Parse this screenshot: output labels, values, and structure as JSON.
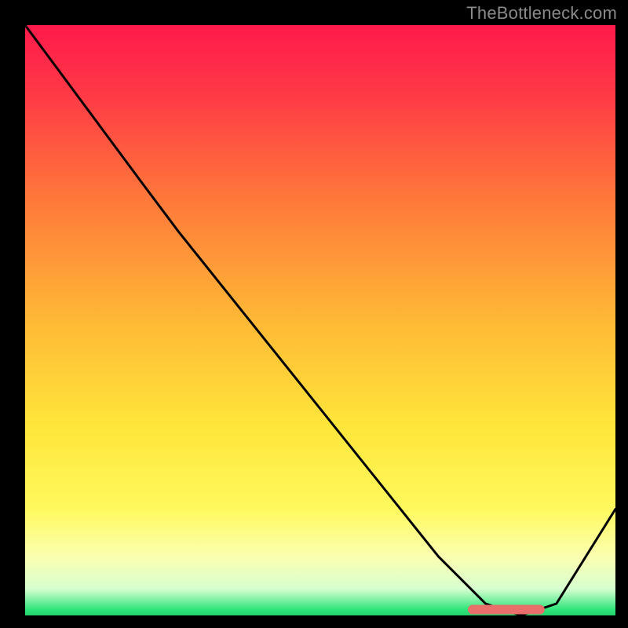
{
  "watermark": "TheBottleneck.com",
  "chart_data": {
    "type": "line",
    "title": "",
    "xlabel": "",
    "ylabel": "",
    "xlim": [
      0,
      100
    ],
    "ylim": [
      0,
      100
    ],
    "series": [
      {
        "name": "bottleneck-curve",
        "x": [
          0,
          20,
          26,
          70,
          78,
          84,
          90,
          100
        ],
        "values": [
          100,
          73,
          65,
          10,
          2,
          0,
          2,
          18
        ]
      }
    ],
    "annotations": [
      {
        "name": "sweet-spot-marker",
        "shape": "rounded-rect",
        "x0": 75,
        "x1": 88,
        "y": 1,
        "color": "#e86f6a"
      }
    ],
    "gradient_stops": [
      {
        "offset": 0.0,
        "color": "#ff1a4b"
      },
      {
        "offset": 0.12,
        "color": "#ff3a46"
      },
      {
        "offset": 0.3,
        "color": "#ff7a3a"
      },
      {
        "offset": 0.5,
        "color": "#ffb836"
      },
      {
        "offset": 0.68,
        "color": "#ffe63a"
      },
      {
        "offset": 0.82,
        "color": "#fff95e"
      },
      {
        "offset": 0.9,
        "color": "#fbffb0"
      },
      {
        "offset": 0.955,
        "color": "#d7ffd0"
      },
      {
        "offset": 0.99,
        "color": "#2fe57a"
      },
      {
        "offset": 1.0,
        "color": "#23d36a"
      }
    ]
  }
}
